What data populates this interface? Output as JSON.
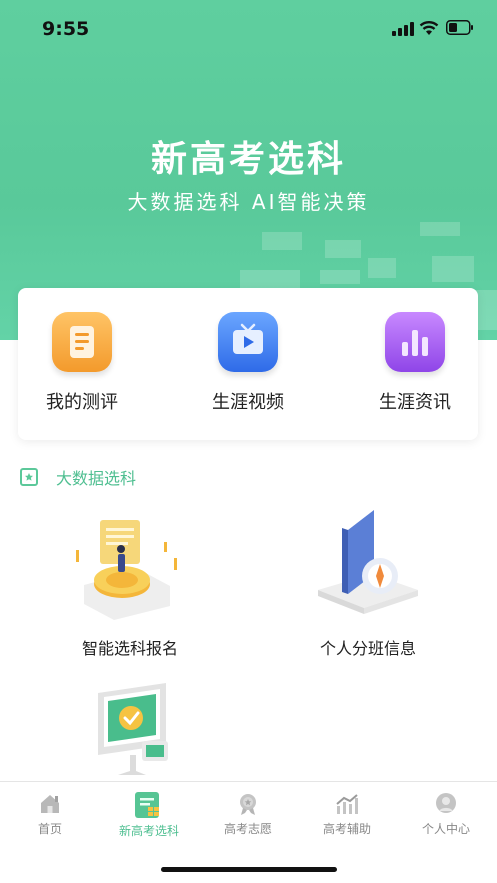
{
  "status": {
    "time": "9:55"
  },
  "hero": {
    "title": "新高考选科",
    "subtitle": "大数据选科 AI智能决策"
  },
  "quick_actions": [
    {
      "label": "我的测评",
      "icon": "document-icon",
      "color": "#f39a2c"
    },
    {
      "label": "生涯视频",
      "icon": "tv-play-icon",
      "color": "#2f6be8"
    },
    {
      "label": "生涯资讯",
      "icon": "bar-chart-icon",
      "color": "#8f45e8"
    }
  ],
  "section": {
    "title": "大数据选科",
    "icon": "star-card-icon"
  },
  "tiles": [
    {
      "label": "智能选科报名",
      "icon": "person-on-coin-illustration"
    },
    {
      "label": "个人分班信息",
      "icon": "compass-book-illustration"
    },
    {
      "label": "",
      "icon": "monitor-check-illustration"
    }
  ],
  "tabs": [
    {
      "label": "首页",
      "icon": "home-icon",
      "active": false
    },
    {
      "label": "新高考选科",
      "icon": "select-subject-icon",
      "active": true
    },
    {
      "label": "高考志愿",
      "icon": "medal-icon",
      "active": false
    },
    {
      "label": "高考辅助",
      "icon": "trend-icon",
      "active": false
    },
    {
      "label": "个人中心",
      "icon": "user-icon",
      "active": false
    }
  ],
  "colors": {
    "brand": "#5cc89a",
    "accent_text": "#4fbf91"
  }
}
